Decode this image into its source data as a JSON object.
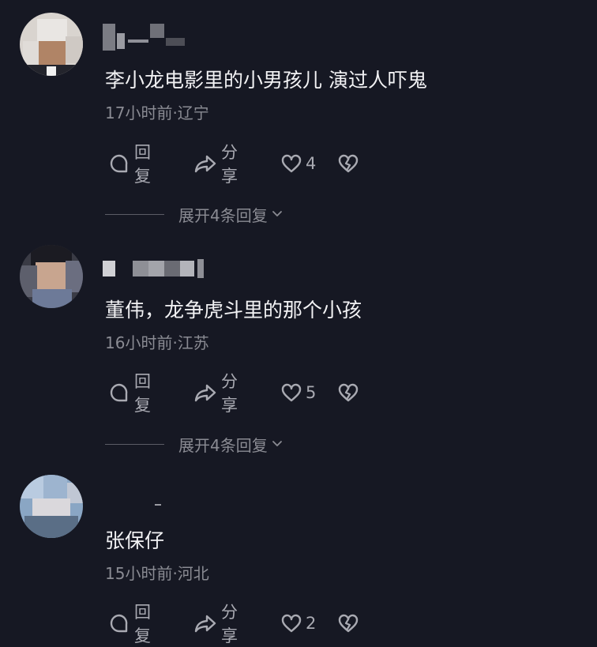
{
  "comments": [
    {
      "text": "李小龙电影里的小男孩儿 演过人吓鬼",
      "meta": "17小时前·辽宁",
      "reply_label": "回复",
      "share_label": "分享",
      "likes": "4",
      "expand_label": "展开4条回复"
    },
    {
      "text": "董伟，龙争虎斗里的那个小孩",
      "meta": "16小时前·江苏",
      "reply_label": "回复",
      "share_label": "分享",
      "likes": "5",
      "expand_label": "展开4条回复"
    },
    {
      "text": "张保仔",
      "meta": "15小时前·河北",
      "reply_label": "回复",
      "share_label": "分享",
      "likes": "2"
    }
  ],
  "icons": {
    "reply": "comment-bubble-icon",
    "share": "share-arrow-icon",
    "like": "heart-icon",
    "dislike": "broken-heart-icon",
    "expand": "chevron-down-icon"
  },
  "colors": {
    "background": "#161823",
    "text": "#f2f2f4",
    "secondary": "#8a8b93",
    "action": "#a9aab2"
  }
}
